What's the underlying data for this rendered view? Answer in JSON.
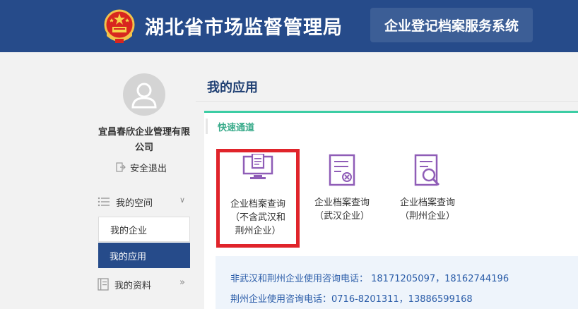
{
  "header": {
    "agency_title": "湖北省市场监督管理局",
    "system_name": "企业登记档案服务系统",
    "emblem_icon": "national-emblem-icon"
  },
  "sidebar": {
    "company_name": "宜昌春欣企业管理有限公司",
    "logout_label": "安全退出",
    "nav": {
      "my_space": "我的空间",
      "my_company": "我的企业",
      "my_apps": "我的应用",
      "my_profile": "我的资料"
    }
  },
  "main": {
    "title": "我的应用",
    "section_title": "快速通道",
    "apps": [
      {
        "line1": "企业档案查询",
        "line2": "（不含武汉和",
        "line3": "荆州企业）",
        "icon": "monitor-document-icon"
      },
      {
        "line1": "企业档案查询",
        "line2": "（武汉企业）",
        "icon": "document-delete-icon"
      },
      {
        "line1": "企业档案查询",
        "line2": "（荆州企业）",
        "icon": "document-search-icon"
      }
    ],
    "info": {
      "line1": "非武汉和荆州企业使用咨询电话： 18171205097，18162744196",
      "line2": "荆州企业使用咨询电话：0716-8201311，13886599168"
    }
  },
  "colors": {
    "header_bg": "#264b8a",
    "accent_green": "#3ccda4",
    "icon_purple": "#8f5db7",
    "highlight_red": "#e0242b"
  }
}
